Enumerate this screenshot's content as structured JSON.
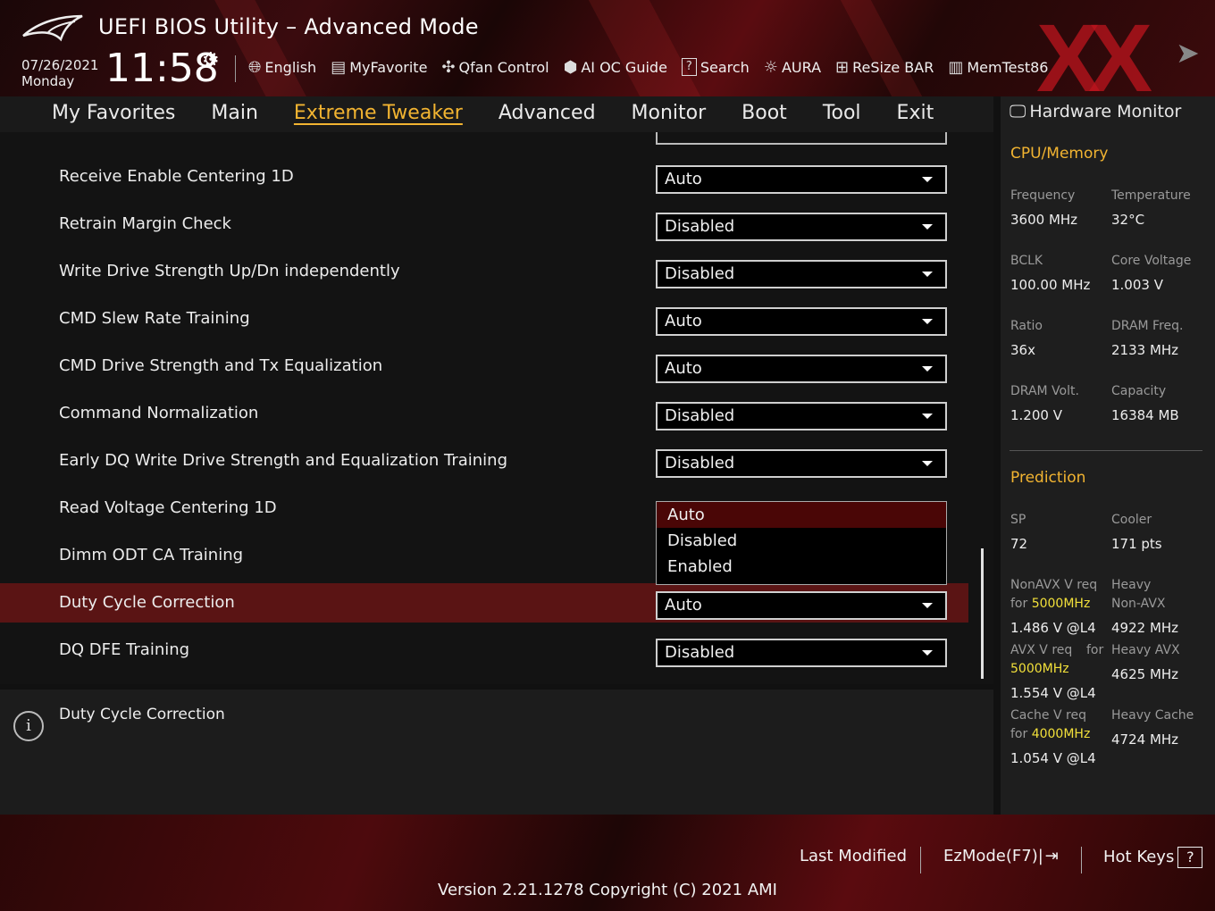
{
  "header": {
    "title": "UEFI BIOS Utility – Advanced Mode",
    "date": "07/26/2021",
    "day": "Monday",
    "time": "11:58",
    "toolbar": [
      {
        "label": "English",
        "icon": "globe-icon"
      },
      {
        "label": "MyFavorite",
        "icon": "favorite-icon"
      },
      {
        "label": "Qfan Control",
        "icon": "fan-icon"
      },
      {
        "label": "AI OC Guide",
        "icon": "ai-chip-icon"
      },
      {
        "label": "Search",
        "icon": "search-icon"
      },
      {
        "label": "AURA",
        "icon": "aura-light-icon"
      },
      {
        "label": "ReSize BAR",
        "icon": "resize-bar-icon"
      },
      {
        "label": "MemTest86",
        "icon": "memory-icon"
      }
    ],
    "watermark": "XX"
  },
  "nav": {
    "tabs": [
      "My Favorites",
      "Main",
      "Extreme Tweaker",
      "Advanced",
      "Monitor",
      "Boot",
      "Tool",
      "Exit"
    ],
    "active": "Extreme Tweaker"
  },
  "settings": [
    {
      "label": "Receive Enable Centering 1D",
      "value": "Auto"
    },
    {
      "label": "Retrain Margin Check",
      "value": "Disabled"
    },
    {
      "label": "Write Drive Strength Up/Dn independently",
      "value": "Disabled"
    },
    {
      "label": "CMD Slew Rate Training",
      "value": "Auto"
    },
    {
      "label": "CMD Drive Strength and Tx Equalization",
      "value": "Auto"
    },
    {
      "label": "Command Normalization",
      "value": "Disabled"
    },
    {
      "label": "Early DQ Write Drive Strength and Equalization Training",
      "value": "Disabled"
    },
    {
      "label": "Read Voltage Centering 1D",
      "value": ""
    },
    {
      "label": "Dimm ODT CA Training",
      "value": ""
    },
    {
      "label": "Duty Cycle Correction",
      "value": "Auto"
    },
    {
      "label": "DQ DFE Training",
      "value": "Disabled"
    }
  ],
  "dropdown": {
    "options": [
      "Auto",
      "Disabled",
      "Enabled"
    ],
    "highlighted": "Auto"
  },
  "help": {
    "text": "Duty Cycle Correction"
  },
  "hardware_monitor": {
    "title": "Hardware Monitor",
    "cpu_memory": {
      "title": "CPU/Memory",
      "frequency_label": "Frequency",
      "frequency": "3600 MHz",
      "temperature_label": "Temperature",
      "temperature": "32°C",
      "bclk_label": "BCLK",
      "bclk": "100.00 MHz",
      "core_voltage_label": "Core Voltage",
      "core_voltage": "1.003 V",
      "ratio_label": "Ratio",
      "ratio": "36x",
      "dram_freq_label": "DRAM Freq.",
      "dram_freq": "2133 MHz",
      "dram_volt_label": "DRAM Volt.",
      "dram_volt": "1.200 V",
      "capacity_label": "Capacity",
      "capacity": "16384 MB"
    },
    "prediction": {
      "title": "Prediction",
      "sp_label": "SP",
      "sp": "72",
      "cooler_label": "Cooler",
      "cooler": "171 pts",
      "nonavx_label": "NonAVX V req",
      "nonavx_for": "for",
      "nonavx_freq": "5000MHz",
      "nonavx_value": "1.486 V @L4",
      "heavy_nonavx_label1": "Heavy",
      "heavy_nonavx_label2": "Non-AVX",
      "heavy_nonavx_value": "4922 MHz",
      "avx_label": "AVX V req",
      "avx_for": "for",
      "avx_freq": "5000MHz",
      "avx_value": "1.554 V @L4",
      "heavy_avx_label": "Heavy AVX",
      "heavy_avx_value": "4625 MHz",
      "cache_label": "Cache V req",
      "cache_for": "for",
      "cache_freq": "4000MHz",
      "cache_value": "1.054 V @L4",
      "heavy_cache_label": "Heavy Cache",
      "heavy_cache_value": "4724 MHz"
    }
  },
  "footer": {
    "last_modified": "Last Modified",
    "ezmode": "EzMode(F7)|",
    "hotkeys": "Hot Keys",
    "hotkeys_key": "?",
    "version": "Version 2.21.1278 Copyright (C) 2021 AMI"
  },
  "colors": {
    "accent": "#f2b431",
    "selected_row": "#5a1414",
    "highlight_yellow": "#f2e03a"
  }
}
